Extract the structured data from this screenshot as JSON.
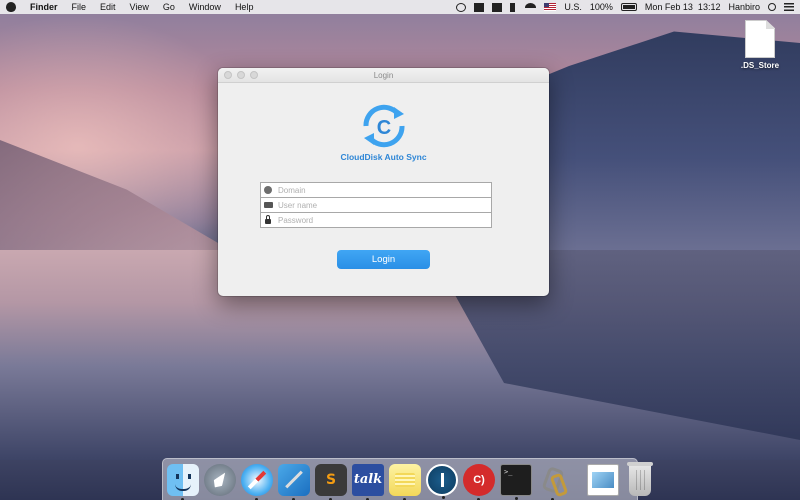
{
  "menubar": {
    "app_name": "Finder",
    "items": [
      "File",
      "Edit",
      "View",
      "Go",
      "Window",
      "Help"
    ],
    "input_source": "U.S.",
    "battery": "100%",
    "datetime": "Mon Feb 13  13:12",
    "user": "Hanbiro"
  },
  "desktop": {
    "file_label": ".DS_Store"
  },
  "window": {
    "title": "Login",
    "app_name": "CloudDisk Auto Sync",
    "logo_letter": "C",
    "fields": {
      "domain_placeholder": "Domain",
      "username_placeholder": "User name",
      "password_placeholder": "Password"
    },
    "login_button": "Login",
    "accent_color": "#2a8fe6"
  },
  "dock": {
    "talk_label": "talk",
    "cloud_label": "C)",
    "terminal_label": ">_"
  }
}
